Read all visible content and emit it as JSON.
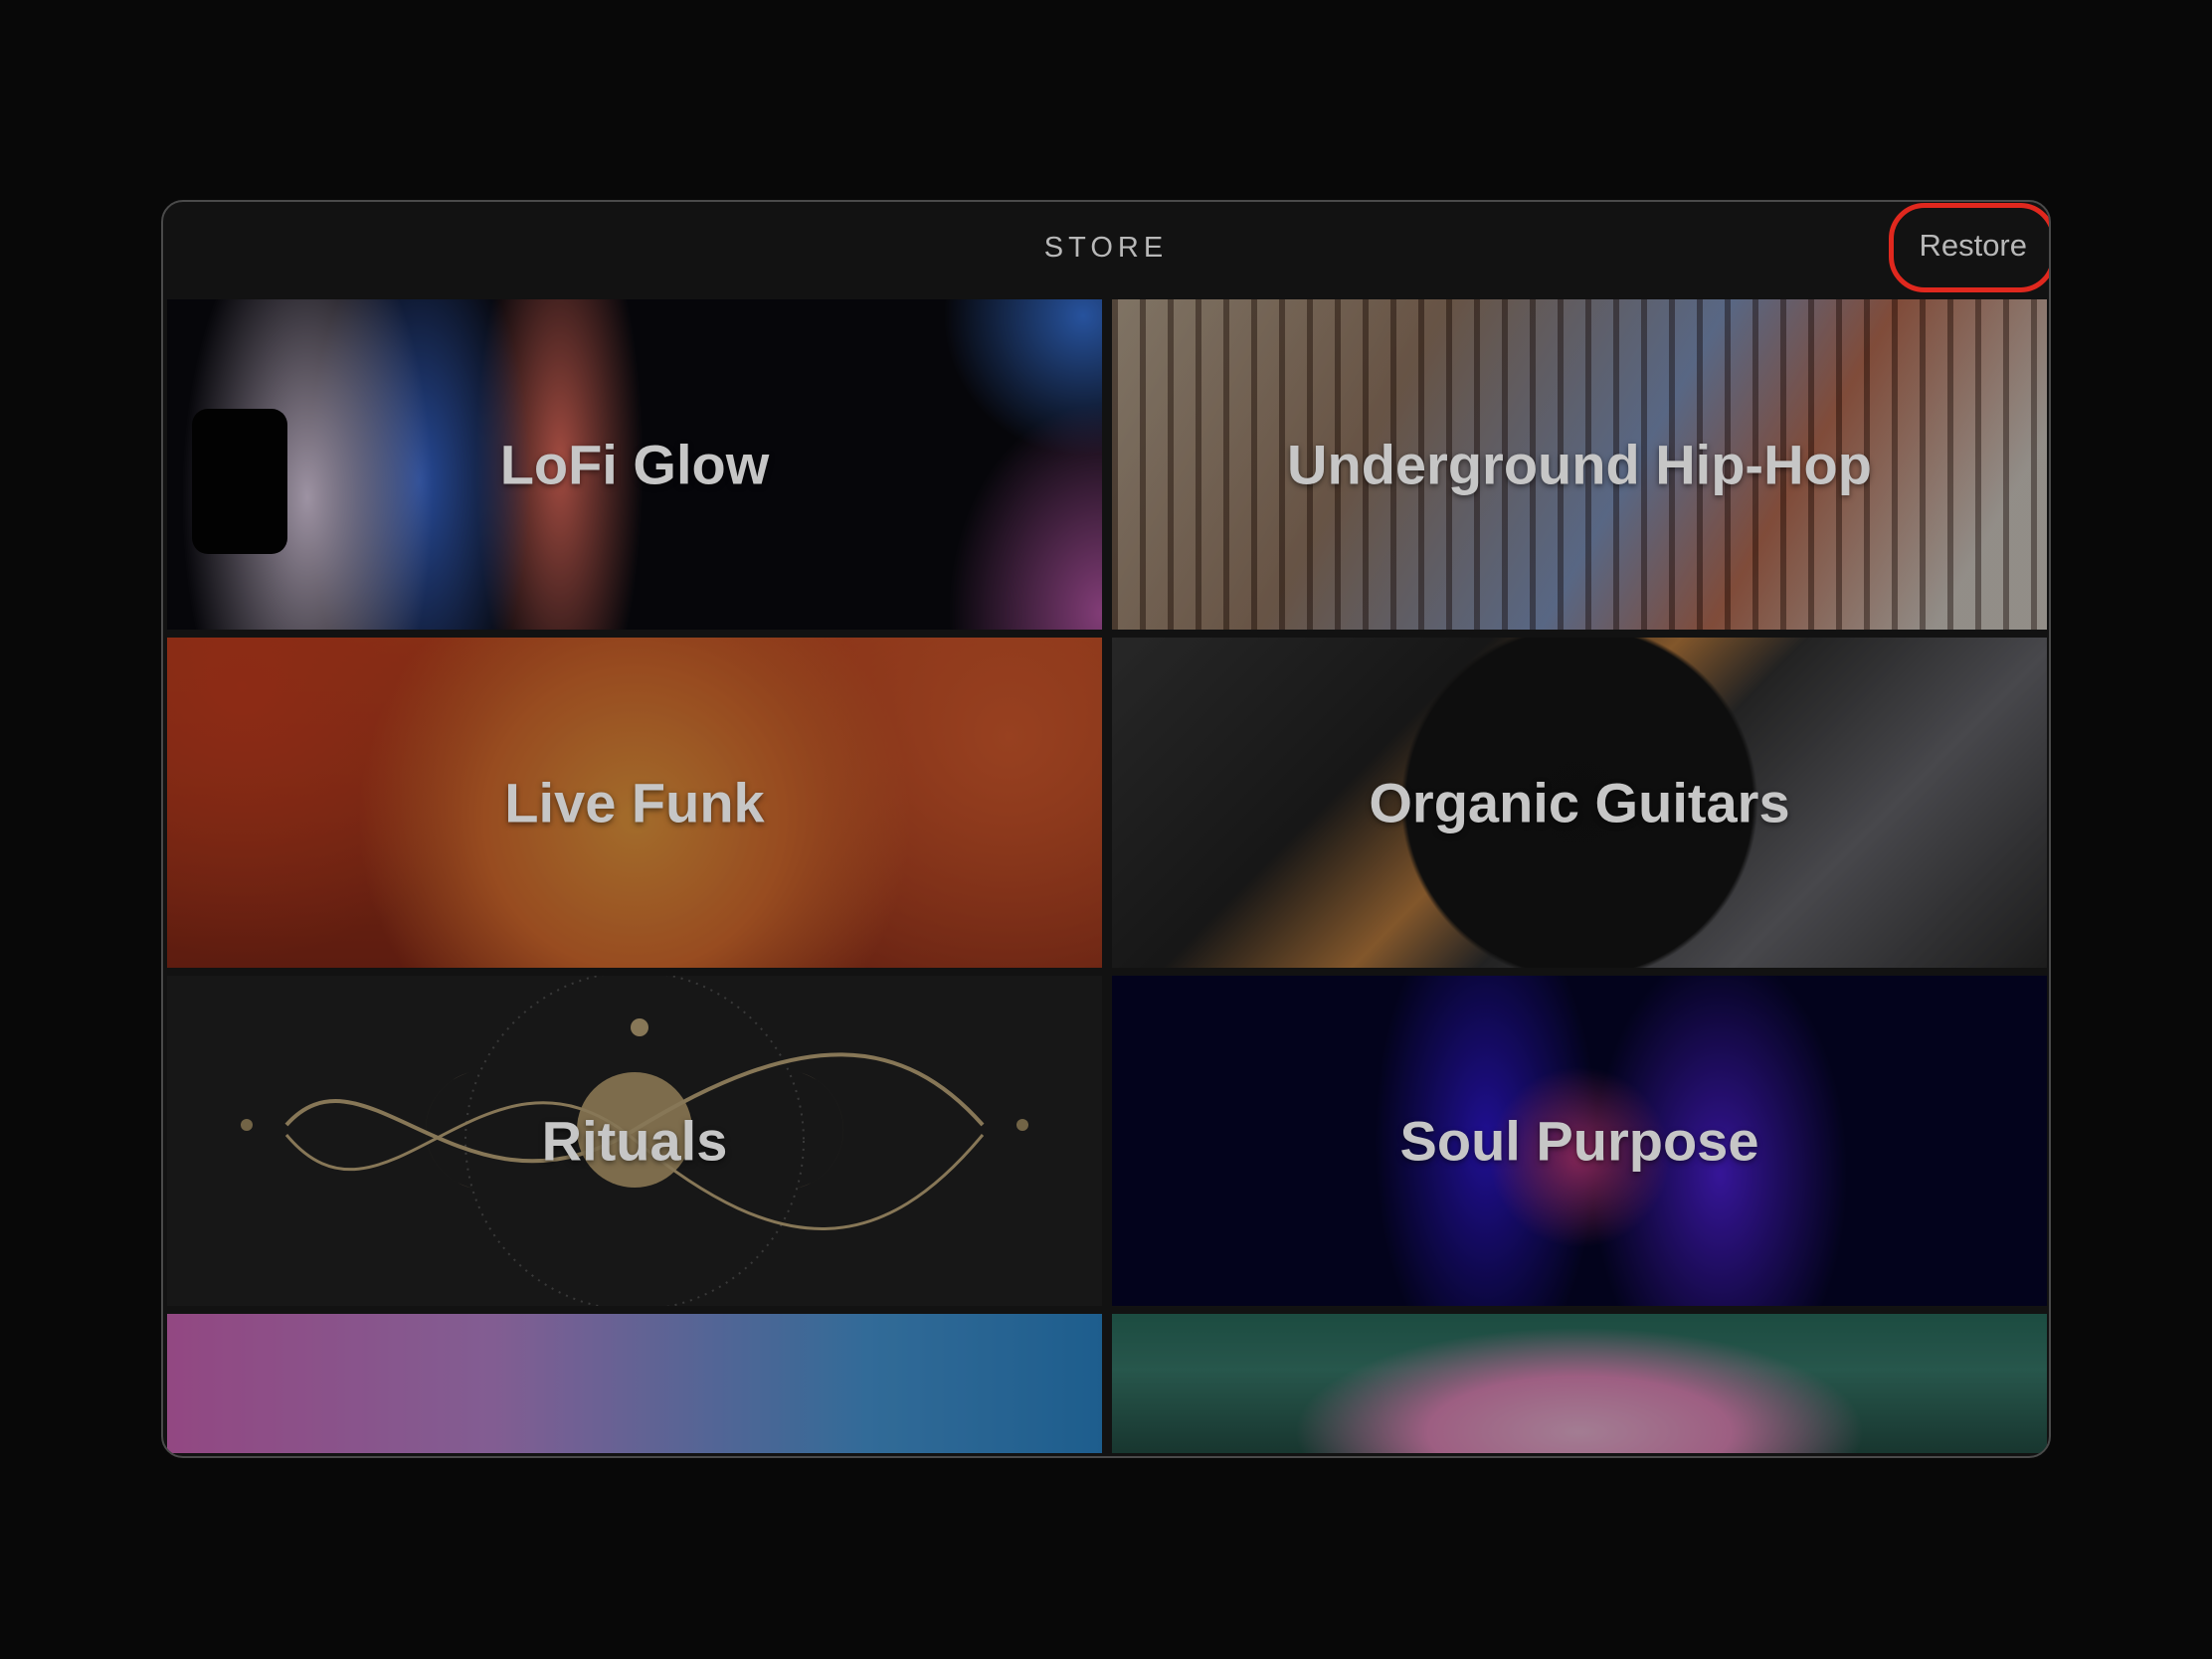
{
  "header": {
    "title": "STORE",
    "restore_label": "Restore"
  },
  "packs": [
    {
      "label": "LoFi Glow"
    },
    {
      "label": "Underground Hip-Hop"
    },
    {
      "label": "Live Funk"
    },
    {
      "label": "Organic Guitars"
    },
    {
      "label": "Rituals"
    },
    {
      "label": "Soul Purpose"
    },
    {
      "label": ""
    },
    {
      "label": ""
    }
  ],
  "colors": {
    "highlight": "#e0281e",
    "background": "#080808",
    "panel": "#121212",
    "text": "#b8b8b8"
  }
}
